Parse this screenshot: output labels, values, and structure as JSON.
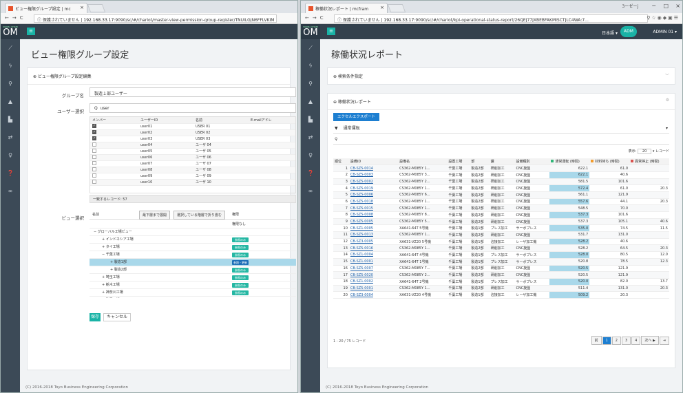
{
  "left": {
    "tab_title": "ビュー権限グループ設定 | mc",
    "addr_warn": "ⓘ 保護されていません",
    "url_host": "192.168.33.17",
    "url_path": ":9090/sc/#/chariot/master-view-permission-group-register/TNUILGJN6FFLVKIM",
    "logo_small": "SIGNAL CHAIN",
    "logo": "OM",
    "page_title": "ビュー権限グループ設定",
    "panel_title": "⊕ ビュー権限グループ設定編集",
    "group_label": "グループ名",
    "group_value": "製造１部ユーザー",
    "user_label": "ユーザー選択",
    "search_icon": "Q",
    "search_value": "user",
    "user_cols": [
      "メンバー",
      "ユーザーID",
      "名前",
      "E-mailアドレ"
    ],
    "users": [
      {
        "checked": true,
        "id": "user01",
        "name": "USER 01"
      },
      {
        "checked": true,
        "id": "user02",
        "name": "USER 02"
      },
      {
        "checked": true,
        "id": "user03",
        "name": "USER 03"
      },
      {
        "checked": false,
        "id": "user04",
        "name": "ユーザ 04"
      },
      {
        "checked": false,
        "id": "user05",
        "name": "ユーザ 05"
      },
      {
        "checked": false,
        "id": "user06",
        "name": "ユーザ 06"
      },
      {
        "checked": false,
        "id": "user07",
        "name": "ユーザ 07"
      },
      {
        "checked": false,
        "id": "user08",
        "name": "ユーザ 08"
      },
      {
        "checked": false,
        "id": "user09",
        "name": "ユーザ 09"
      },
      {
        "checked": false,
        "id": "user10",
        "name": "ユーザ 10"
      }
    ],
    "match_count": "一致するレコード: 57",
    "view_label": "ビュー選択",
    "view_col_name": "名前",
    "expand_btn": "最下層まで展開",
    "collapse_btn": "選択している階層で折り畳む",
    "view_col_perm": "権限",
    "perm_none": "権限なし",
    "tree": [
      {
        "label": "− グローバル工場ビュー",
        "indent": 0,
        "badge": ""
      },
      {
        "label": "+ インドネシア工場",
        "indent": 1,
        "badge": "参照のみ"
      },
      {
        "label": "+ タイ工場",
        "indent": 1,
        "badge": "参照のみ"
      },
      {
        "label": "− 千葉工場",
        "indent": 1,
        "badge": "参照のみ"
      },
      {
        "label": "+ 製造1部",
        "indent": 2,
        "badge": "参照・更新",
        "selected": true
      },
      {
        "label": "+ 製造2部",
        "indent": 2,
        "badge": "参照のみ"
      },
      {
        "label": "+ 埼玉工場",
        "indent": 1,
        "badge": "参照のみ"
      },
      {
        "label": "+ 栃木工場",
        "indent": 1,
        "badge": "参照のみ"
      },
      {
        "label": "+ 神奈川工場",
        "indent": 1,
        "badge": "参照のみ"
      },
      {
        "label": "+ 群馬工場",
        "indent": 1,
        "badge": "参照のみ"
      }
    ],
    "save": "保存",
    "cancel": "キャンセル",
    "footer": "(C) 2016-2018 Toyo Business Engineering Corporation"
  },
  "right": {
    "tab_title": "稼働状況レポート | mcfram",
    "user_glyph": "3ーゼーj",
    "addr_warn": "ⓘ 保護されていません",
    "url_host": "192.168.33.17",
    "url_path": ":9090/sc/#/chariot/kpi-operational-status-report/26QEJ77JXBEBFAKMISCTJLC4WA:7...",
    "lang": "日本語 ▾",
    "avatar": "ADM",
    "user": "ADMIN 01 ▾",
    "page_title": "稼働状況レポート",
    "search_panel": "⊕ 検索条件指定",
    "report_panel": "⊕ 稼働状況レポート",
    "excel_btn": "エクセルエクスポート",
    "filter_value": "通常運転",
    "display_label": "表示:",
    "display_count": "20",
    "display_unit": "▾ レコード",
    "cols": [
      "順位",
      "設備ID",
      "設備名",
      "設置工場",
      "部",
      "課",
      "設備種別",
      "通常運転 (時間)",
      "材料待ち (時間)",
      "異常停止 (時間)"
    ],
    "legend_colors": {
      "run": "#2fb577",
      "wait": "#f29b2b",
      "stop": "#d9534f"
    },
    "rows": [
      [
        "1",
        "CB-SZ5-0014",
        "CS362-M085Y 1...",
        "千葉工場",
        "製造2部",
        "研削加工",
        "CNC旋盤",
        "622.1",
        "61.0",
        ""
      ],
      [
        "2",
        "CB-SZ5-0003",
        "CS362-M085Y 3...",
        "千葉工場",
        "製造2部",
        "研削加工",
        "CNC旋盤",
        "622.1",
        "40.6",
        ""
      ],
      [
        "3",
        "CB-SZ5-0002",
        "CS362-M085Y 2...",
        "千葉工場",
        "製造2部",
        "研削加工",
        "CNC旋盤",
        "581.5",
        "101.6",
        ""
      ],
      [
        "4",
        "CB-SZ5-0019",
        "CS362-M085Y 1...",
        "千葉工場",
        "製造2部",
        "研削加工",
        "CNC旋盤",
        "572.4",
        "61.0",
        "20.3"
      ],
      [
        "5",
        "CB-SZ5-0006",
        "CS362-M085Y 6...",
        "千葉工場",
        "製造2部",
        "研削加工",
        "CNC旋盤",
        "561.1",
        "121.9",
        ""
      ],
      [
        "6",
        "CB-SZ5-0018",
        "CS362-M085Y 1...",
        "千葉工場",
        "製造2部",
        "研削加工",
        "CNC旋盤",
        "557.6",
        "44.1",
        "20.3"
      ],
      [
        "7",
        "CB-SZ5-0015",
        "CS362-M085Y 1...",
        "千葉工場",
        "製造2部",
        "研削加工",
        "CNC旋盤",
        "548.5",
        "70.0",
        ""
      ],
      [
        "8",
        "CB-SZ5-0008",
        "CS362-M085Y 8...",
        "千葉工場",
        "製造2部",
        "研削加工",
        "CNC旋盤",
        "537.3",
        "101.6",
        ""
      ],
      [
        "9",
        "CB-SZ5-0005",
        "CS362-M085Y 5...",
        "千葉工場",
        "製造2部",
        "研削加工",
        "CNC旋盤",
        "537.3",
        "105.1",
        "40.6"
      ],
      [
        "10",
        "CB-SZ1-0005",
        "XA641-64T 5号機",
        "千葉工場",
        "製造1部",
        "プレス加工",
        "サーボプレス",
        "535.0",
        "74.5",
        "11.5"
      ],
      [
        "11",
        "CB-SZ5-0013",
        "CS362-M085Y 1...",
        "千葉工場",
        "製造2部",
        "研削加工",
        "CNC旋盤",
        "531.7",
        "131.0",
        ""
      ],
      [
        "12",
        "CB-SZ3-0005",
        "XA631-VZ20 5号機",
        "千葉工場",
        "製造1部",
        "溶接加工",
        "レーザ加工機",
        "528.2",
        "40.6",
        ""
      ],
      [
        "13",
        "CB-SZ5-0016",
        "CS362-M085Y 1...",
        "千葉工場",
        "製造2部",
        "研削加工",
        "CNC旋盤",
        "528.2",
        "64.5",
        "20.3"
      ],
      [
        "14",
        "CB-SZ1-0004",
        "XA641-64T 4号機",
        "千葉工場",
        "製造1部",
        "プレス加工",
        "サーボプレス",
        "528.0",
        "80.5",
        "12.0"
      ],
      [
        "15",
        "CB-SZ1-0001",
        "XA641-64T 1号機",
        "千葉工場",
        "製造1部",
        "プレス加工",
        "サーボプレス",
        "520.8",
        "78.5",
        "12.3"
      ],
      [
        "16",
        "CB-SZ5-0007",
        "CS362-M085Y 7...",
        "千葉工場",
        "製造2部",
        "研削加工",
        "CNC旋盤",
        "520.5",
        "121.9",
        ""
      ],
      [
        "17",
        "CB-SZ5-0020",
        "CS362-M085Y 2...",
        "千葉工場",
        "製造2部",
        "研削加工",
        "CNC旋盤",
        "520.5",
        "121.9",
        ""
      ],
      [
        "18",
        "CB-SZ1-0002",
        "XA641-64T 2号機",
        "千葉工場",
        "製造1部",
        "プレス加工",
        "サーボプレス",
        "520.0",
        "82.0",
        "13.7"
      ],
      [
        "19",
        "CB-SZ5-0001",
        "CS362-M085Y 1...",
        "千葉工場",
        "製造2部",
        "研削加工",
        "CNC旋盤",
        "511.4",
        "131.0",
        "20.3"
      ],
      [
        "20",
        "CB-SZ3-0004",
        "XA631-VZ20 4号機",
        "千葉工場",
        "製造1部",
        "溶接加工",
        "レーザ加工機",
        "509.2",
        "20.3",
        ""
      ]
    ],
    "record_info": "1 - 20 / 75 レコード",
    "pager": [
      "前",
      "1",
      "2",
      "3",
      "4",
      "次へ ▶",
      "⇥"
    ],
    "footer": "(C) 2016-2018 Toyo Business Engineering Corporation"
  }
}
